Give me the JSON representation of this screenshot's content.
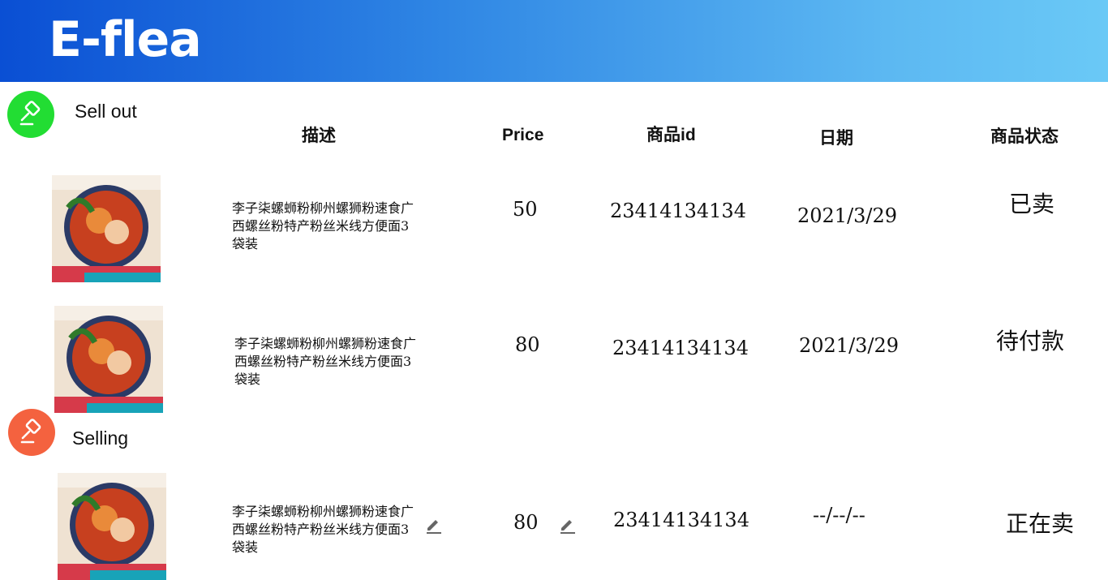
{
  "app": {
    "title": "E-flea"
  },
  "colors": {
    "header_start": "#0a4fd4",
    "header_end": "#6ac9f6",
    "sold_icon": "#22dd33",
    "selling_icon": "#f4623f"
  },
  "sections": {
    "sold": {
      "title": "Sell out",
      "icon": "gavel-icon"
    },
    "selling": {
      "title": "Selling",
      "icon": "gavel-icon"
    }
  },
  "columns": {
    "description": "描述",
    "price": "Price",
    "product_id": "商品id",
    "date": "日期",
    "status": "商品状态"
  },
  "rows": [
    {
      "image": "noodle-product-image",
      "description": "李子柒螺蛳粉柳州螺狮粉速食广西螺丝粉特产粉丝米线方便面3袋装",
      "price": "50",
      "product_id": "23414134134",
      "date": "2021/3/29",
      "status": "已卖"
    },
    {
      "image": "noodle-product-image",
      "description": "李子柒螺蛳粉柳州螺狮粉速食广西螺丝粉特产粉丝米线方便面3袋装",
      "price": "80",
      "product_id": "23414134134",
      "date": "2021/3/29",
      "status": "待付款"
    },
    {
      "image": "noodle-product-image",
      "description": "李子柒螺蛳粉柳州螺狮粉速食广西螺丝粉特产粉丝米线方便面3袋装",
      "price": "80",
      "product_id": "23414134134",
      "date": "--/--/--",
      "status": "正在卖",
      "editable": true,
      "edit_icon": "pencil-icon"
    }
  ]
}
